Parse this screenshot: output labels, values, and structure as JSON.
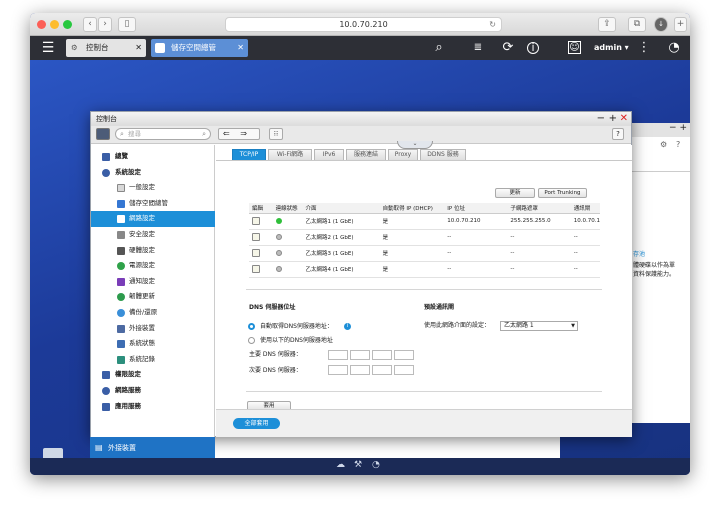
{
  "browser": {
    "url": "10.0.70.210"
  },
  "qts": {
    "tabs": [
      {
        "label": "控制台"
      },
      {
        "label": "儲存空間總管"
      }
    ],
    "user": "admin ▾"
  },
  "window": {
    "title": "控制台",
    "search_placeholder": "搜尋",
    "sidebar": {
      "items": [
        {
          "label": "總覽"
        },
        {
          "label": "系統設定"
        },
        {
          "label": "一般設定"
        },
        {
          "label": "儲存空間總管"
        },
        {
          "label": "網路設定"
        },
        {
          "label": "安全設定"
        },
        {
          "label": "硬體設定"
        },
        {
          "label": "電源設定"
        },
        {
          "label": "通知設定"
        },
        {
          "label": "韌體更新"
        },
        {
          "label": "備份/還原"
        },
        {
          "label": "外接裝置"
        },
        {
          "label": "系統狀態"
        },
        {
          "label": "系統記錄"
        },
        {
          "label": "權限設定"
        },
        {
          "label": "網路服務"
        },
        {
          "label": "應用服務"
        }
      ],
      "bottom_label": "外接裝置"
    },
    "tabs": [
      "TCP/IP",
      "Wi-Fi網路",
      "IPv6",
      "服務連結",
      "Proxy",
      "DDNS 服務"
    ],
    "buttons": {
      "refresh": "更新",
      "port_trunking": "Port Trunking",
      "apply_all": "全部套用",
      "apply": "套用"
    },
    "nic_table": {
      "headers": [
        "編輯",
        "連線狀態",
        "介面",
        "自動取得 IP (DHCP)",
        "IP 位址",
        "子網路遮罩",
        "通訊閘"
      ],
      "rows": [
        {
          "iface": "乙太網路1 (1 GbE)",
          "dhcp": "是",
          "ip": "10.0.70.210",
          "mask": "255.255.255.0",
          "gw": "10.0.70.1",
          "status": "green"
        },
        {
          "iface": "乙太網路2 (1 GbE)",
          "dhcp": "是",
          "ip": "--",
          "mask": "--",
          "gw": "--",
          "status": "gray"
        },
        {
          "iface": "乙太網路3 (1 GbE)",
          "dhcp": "是",
          "ip": "--",
          "mask": "--",
          "gw": "--",
          "status": "gray"
        },
        {
          "iface": "乙太網路4 (1 GbE)",
          "dhcp": "是",
          "ip": "--",
          "mask": "--",
          "gw": "--",
          "status": "gray"
        }
      ]
    },
    "dns": {
      "title": "DNS 伺服器位址",
      "auto": "自動取得DNS伺服器地址：",
      "manual": "使用以下的DNS伺服器地址",
      "primary": "主要 DNS 伺服器：",
      "secondary": "次要 DNS 伺服器："
    },
    "gateway": {
      "title": "預設通訊閘",
      "label": "使用此網路介面的設定：",
      "selected": "乙太網路 1"
    }
  },
  "right_window": {
    "line1": "存池",
    "line2": "體硬碟以作為單",
    "line3": "資料保護能力。"
  },
  "colors": {
    "accent": "#1d8fd8",
    "desktop": "#1f3f9e"
  }
}
